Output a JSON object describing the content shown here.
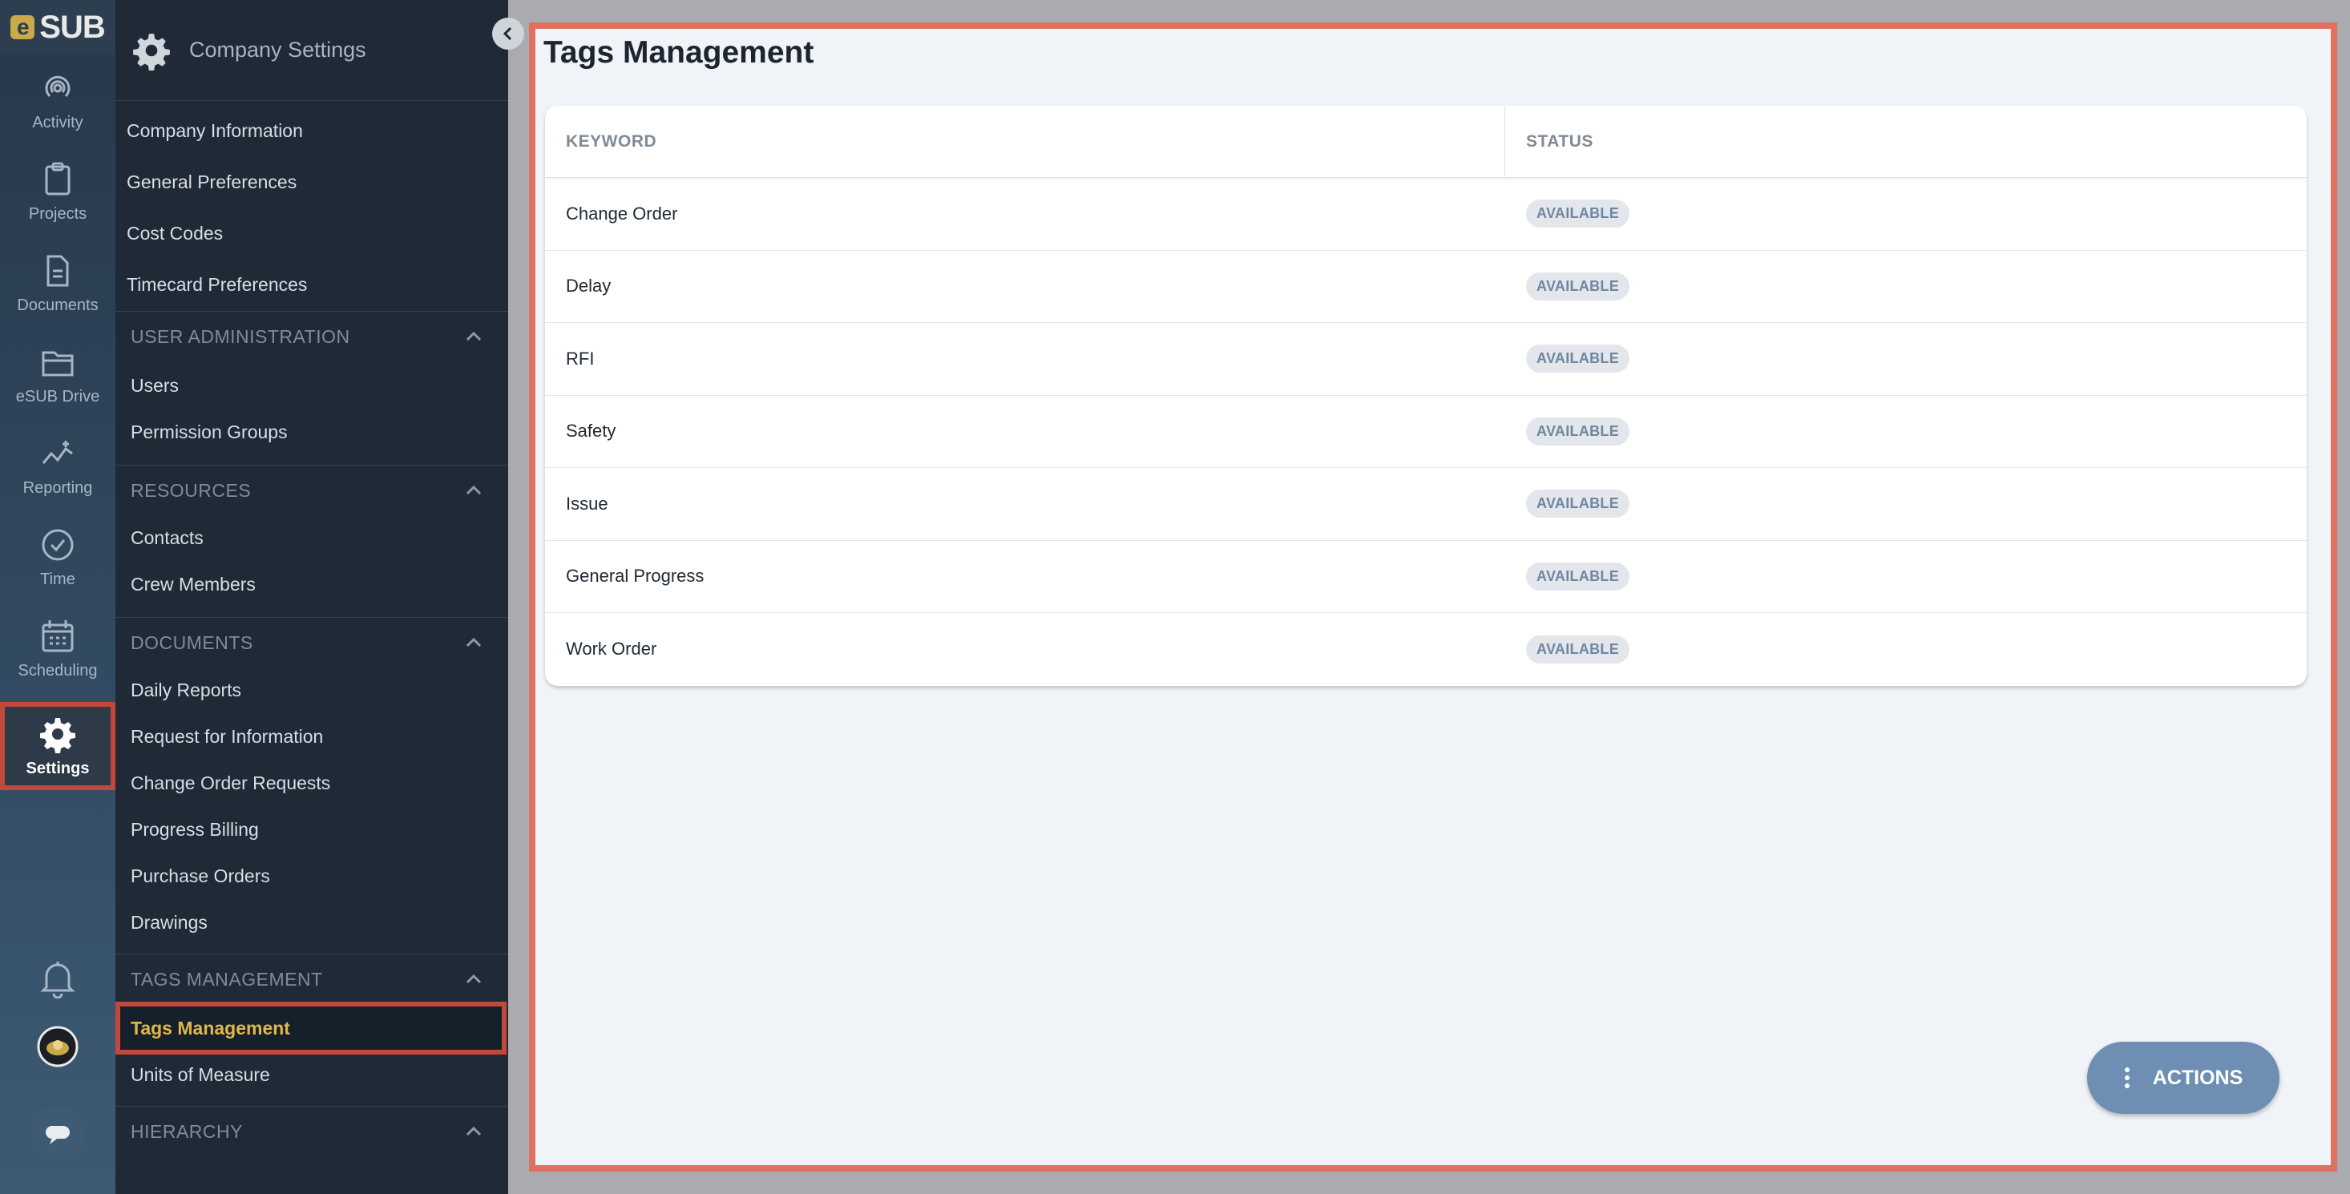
{
  "brand": {
    "logo_text": "SUB",
    "logo_letter": "e"
  },
  "rail": {
    "items": [
      {
        "label": "Activity",
        "icon": "activity-icon"
      },
      {
        "label": "Projects",
        "icon": "clipboard-icon"
      },
      {
        "label": "Documents",
        "icon": "document-icon"
      },
      {
        "label": "eSUB Drive",
        "icon": "folder-icon"
      },
      {
        "label": "Reporting",
        "icon": "chart-line-icon"
      },
      {
        "label": "Time",
        "icon": "clock-check-icon"
      },
      {
        "label": "Scheduling",
        "icon": "calendar-icon"
      },
      {
        "label": "Settings",
        "icon": "gear-icon"
      }
    ]
  },
  "sidebar": {
    "title": "Company Settings",
    "top_links": [
      "Company Information",
      "General Preferences",
      "Cost Codes",
      "Timecard Preferences"
    ],
    "sections": [
      {
        "title": "USER ADMINISTRATION",
        "items": [
          "Users",
          "Permission Groups"
        ]
      },
      {
        "title": "RESOURCES",
        "items": [
          "Contacts",
          "Crew Members"
        ]
      },
      {
        "title": "DOCUMENTS",
        "items": [
          "Daily Reports",
          "Request for Information",
          "Change Order Requests",
          "Progress Billing",
          "Purchase Orders",
          "Drawings"
        ]
      },
      {
        "title": "TAGS MANAGEMENT",
        "items": [
          "Tags Management",
          "Units of Measure"
        ]
      },
      {
        "title": "HIERARCHY",
        "items": []
      }
    ]
  },
  "main": {
    "title": "Tags Management",
    "columns": {
      "keyword": "KEYWORD",
      "status": "STATUS"
    },
    "rows": [
      {
        "keyword": "Change Order",
        "status": "AVAILABLE"
      },
      {
        "keyword": "Delay",
        "status": "AVAILABLE"
      },
      {
        "keyword": "RFI",
        "status": "AVAILABLE"
      },
      {
        "keyword": "Safety",
        "status": "AVAILABLE"
      },
      {
        "keyword": "Issue",
        "status": "AVAILABLE"
      },
      {
        "keyword": "General Progress",
        "status": "AVAILABLE"
      },
      {
        "keyword": "Work Order",
        "status": "AVAILABLE"
      }
    ],
    "actions_label": "ACTIONS"
  },
  "colors": {
    "accent": "#e0b74a",
    "highlight": "#c0493a",
    "button": "#6e8fb3",
    "badge_text": "#6f86a3"
  }
}
